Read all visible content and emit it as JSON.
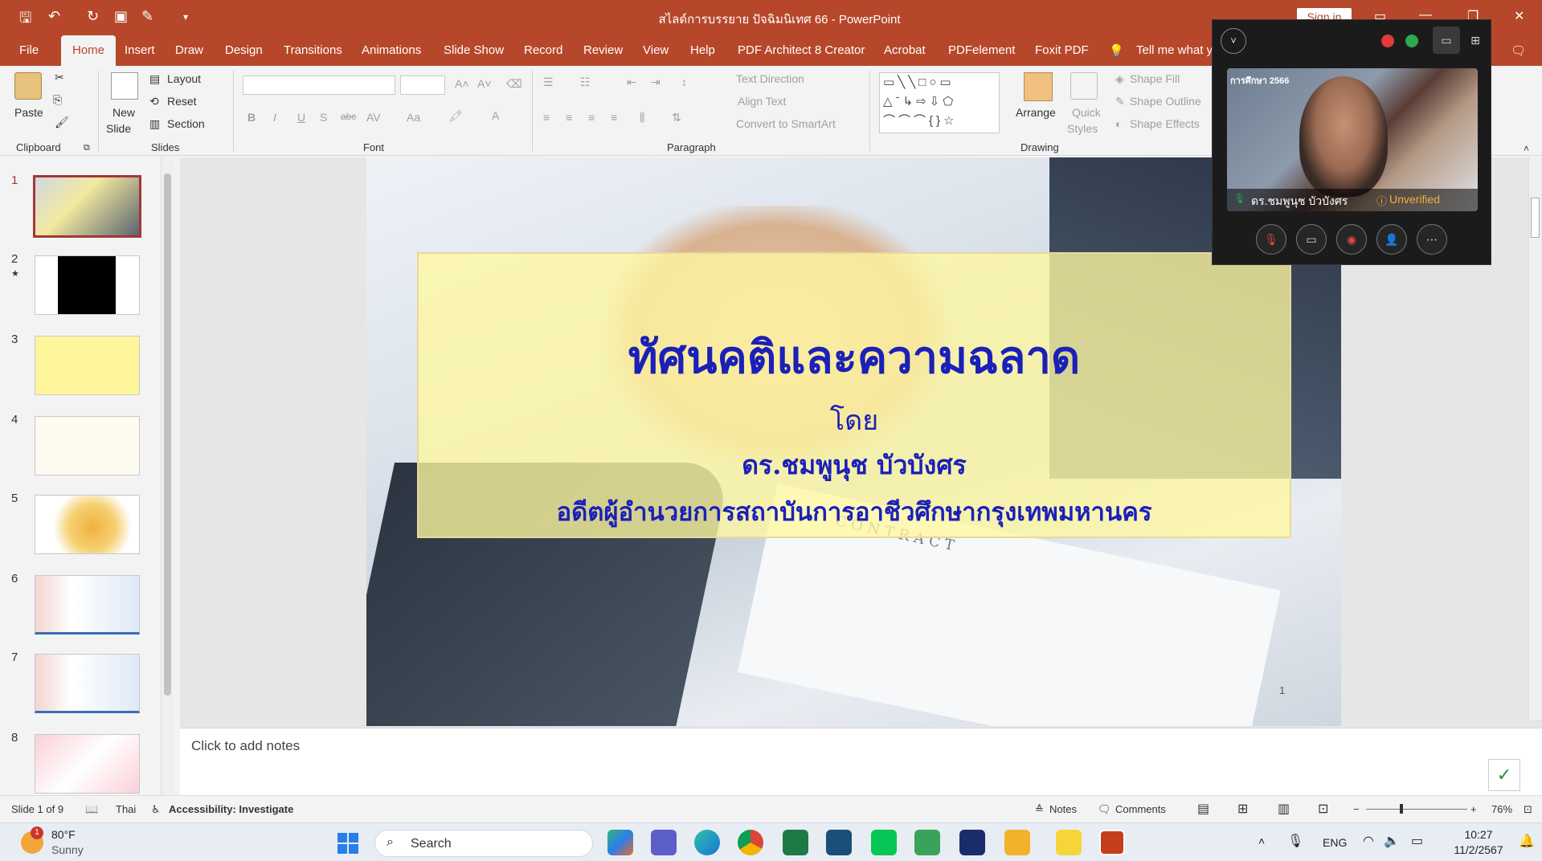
{
  "window": {
    "title": "สไลด์การบรรยาย ปัจฉิมนิเทศ 66  -  PowerPoint",
    "sign_in": "Sign in"
  },
  "menu": {
    "file": "File",
    "tabs": [
      "Home",
      "Insert",
      "Draw",
      "Design",
      "Transitions",
      "Animations",
      "Slide Show",
      "Record",
      "Review",
      "View",
      "Help",
      "PDF Architect 8 Creator",
      "Acrobat",
      "PDFelement",
      "Foxit PDF"
    ],
    "tell_me": "Tell me what y"
  },
  "ribbon": {
    "clipboard": {
      "label": "Clipboard",
      "paste": "Paste"
    },
    "slides": {
      "label": "Slides",
      "new_slide_1": "New",
      "new_slide_2": "Slide",
      "layout": "Layout",
      "reset": "Reset",
      "section": "Section"
    },
    "font": {
      "label": "Font",
      "buttons": [
        "B",
        "I",
        "U",
        "S",
        "abc",
        "AV",
        "Aa",
        "A"
      ]
    },
    "paragraph": {
      "label": "Paragraph",
      "text_direction": "Text Direction",
      "align_text": "Align Text",
      "convert_smartart": "Convert to SmartArt"
    },
    "drawing": {
      "label": "Drawing",
      "arrange": "Arrange",
      "quick_styles_1": "Quick",
      "quick_styles_2": "Styles",
      "shape_fill": "Shape Fill",
      "shape_outline": "Shape Outline",
      "shape_effects": "Shape Effects"
    }
  },
  "thumbnails": [
    "1",
    "2",
    "3",
    "4",
    "5",
    "6",
    "7",
    "8"
  ],
  "slide": {
    "title": "ทัศนคติและความฉลาด",
    "by": "โดย",
    "author": "ดร.ชมพูนุช  บัวบังศร",
    "position": "อดีตผู้อำนวยการสถาบันการอาชีวศึกษากรุงเทพมหานคร",
    "number": "1",
    "contract_text": "CONTRACT"
  },
  "notes": {
    "placeholder": "Click to add notes"
  },
  "status": {
    "slide_of": "Slide 1 of 9",
    "language": "Thai",
    "accessibility": "Accessibility: Investigate",
    "notes": "Notes",
    "comments": "Comments",
    "zoom": "76%"
  },
  "call": {
    "participant": "ดร.ชมพูนุช บัวบังศร",
    "verification": "Unverified",
    "video_text": "การศึกษา 2566"
  },
  "taskbar": {
    "weather_temp": "80°F",
    "weather_desc": "Sunny",
    "search": "Search",
    "lang": "ENG",
    "time": "10:27",
    "date": "11/2/2567"
  },
  "colors": {
    "accent": "#b7472a",
    "slide_title": "#1b20b8",
    "selection": "#a4373a"
  }
}
